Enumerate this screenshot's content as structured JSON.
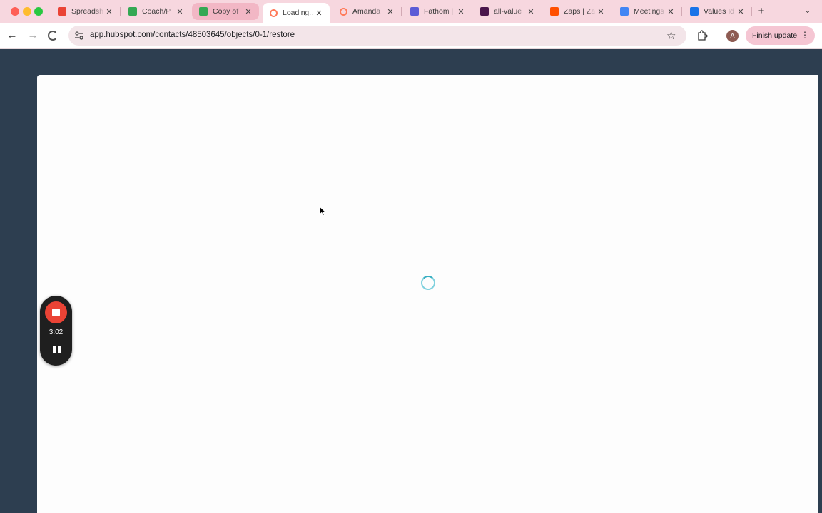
{
  "browser": {
    "tabs": [
      {
        "title": "Spreadsh",
        "favicon": "gmail-icon",
        "color": "#ea4335",
        "state": "normal"
      },
      {
        "title": "Coach/P",
        "favicon": "sheets-icon",
        "color": "#34a853",
        "state": "normal"
      },
      {
        "title": "Copy of",
        "favicon": "sheets-icon",
        "color": "#34a853",
        "state": "highlighted"
      },
      {
        "title": "Loading...",
        "favicon": "hubspot-loading-icon",
        "color": "#ff7a59",
        "state": "active"
      },
      {
        "title": "Amanda",
        "favicon": "hubspot-icon",
        "color": "#ff7a59",
        "state": "normal"
      },
      {
        "title": "Fathom |",
        "favicon": "fathom-icon",
        "color": "#5b5bd6",
        "state": "normal"
      },
      {
        "title": "all-value",
        "favicon": "slack-icon",
        "color": "#4a154b",
        "state": "normal"
      },
      {
        "title": "Zaps | Za",
        "favicon": "zapier-icon",
        "color": "#ff4f00",
        "state": "normal"
      },
      {
        "title": "Meetings",
        "favicon": "docs-icon",
        "color": "#4285f4",
        "state": "normal"
      },
      {
        "title": "Values Id",
        "favicon": "calendar-icon",
        "color": "#1a73e8",
        "state": "normal"
      }
    ],
    "new_tab_symbol": "+",
    "url": "app.hubspot.com/contacts/48503645/objects/0-1/restore",
    "profile_initial": "A",
    "finish_update_label": "Finish update"
  },
  "recorder": {
    "elapsed": "3:02"
  },
  "colors": {
    "tabstrip": "#f7d7df",
    "page_background": "#2d3e50",
    "spinner": "#36aec1",
    "record": "#ea4335"
  }
}
